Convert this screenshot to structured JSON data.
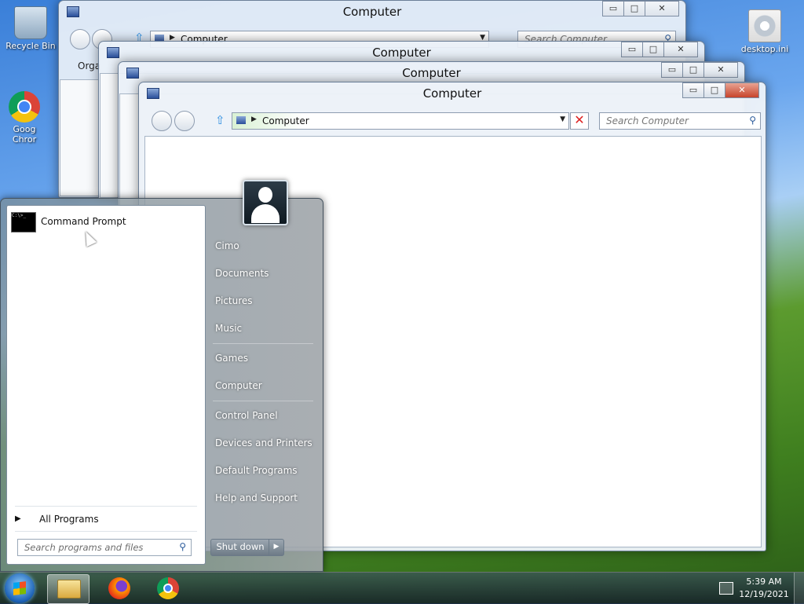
{
  "desktop": {
    "icons": [
      {
        "label": "Recycle Bin",
        "icon": "recycle-bin-icon"
      },
      {
        "label": "Goog Chror",
        "icon": "chrome-icon"
      },
      {
        "label": "desktop.ini",
        "icon": "settings-file-icon"
      }
    ]
  },
  "windows": [
    {
      "title": "Computer",
      "address": "Computer",
      "search_placeholder": "Search Computer",
      "toolbar_partial": "Orga"
    },
    {
      "title": "Computer"
    },
    {
      "title": "Computer"
    },
    {
      "title": "Computer",
      "address": "Computer",
      "search_placeholder": "Search Computer"
    }
  ],
  "window_controls": {
    "minimize": "▭",
    "maximize": "□",
    "close": "✕"
  },
  "start_menu": {
    "programs": [
      {
        "label": "Command Prompt",
        "icon": "command-prompt-icon"
      }
    ],
    "all_programs": "All Programs",
    "search_placeholder": "Search programs and files",
    "right_items": [
      {
        "label": "Cimo"
      },
      {
        "label": "Documents"
      },
      {
        "label": "Pictures"
      },
      {
        "label": "Music"
      },
      {
        "label": "Games"
      },
      {
        "label": "Computer"
      },
      {
        "label": "Control Panel"
      },
      {
        "label": "Devices and Printers"
      },
      {
        "label": "Default Programs"
      },
      {
        "label": "Help and Support"
      }
    ],
    "shutdown": "Shut down",
    "shutdown_arrow": "▶"
  },
  "taskbar": {
    "time": "5:39 AM",
    "date": "12/19/2021",
    "pinned": [
      "windows-explorer",
      "firefox",
      "chrome"
    ]
  },
  "colors": {
    "accent": "#2d8ee0",
    "close_button": "#c7442c"
  }
}
